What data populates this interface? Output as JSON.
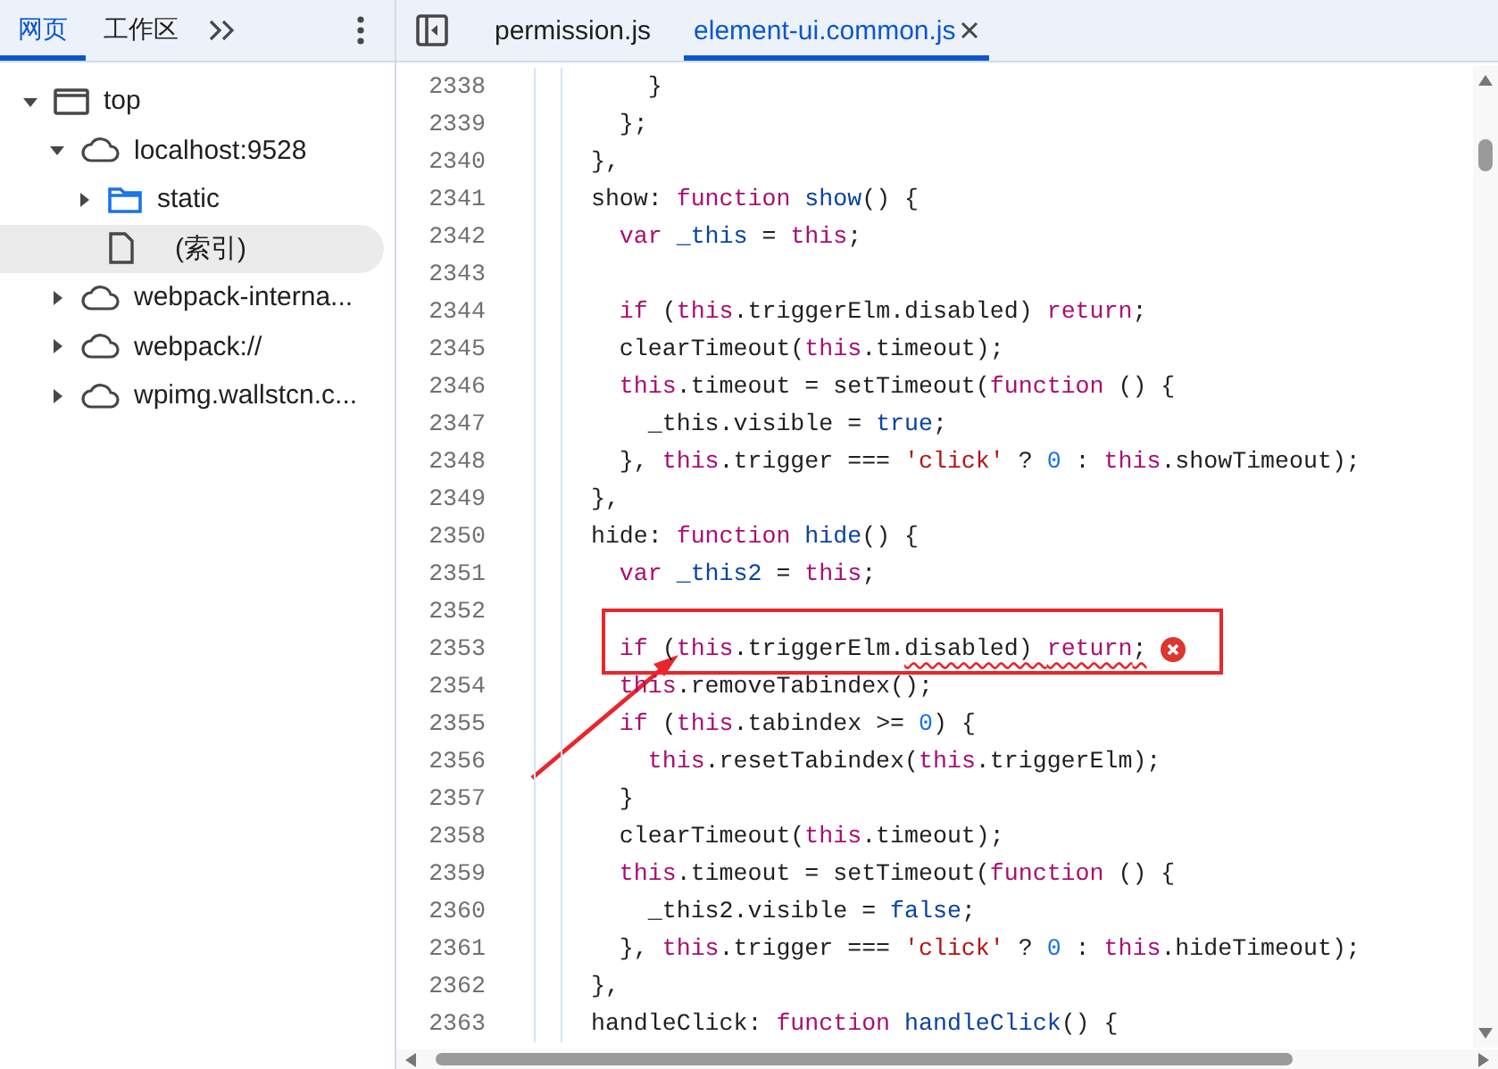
{
  "left_panel": {
    "tabs": [
      {
        "label": "网页",
        "selected": true
      },
      {
        "label": "工作区",
        "selected": false
      }
    ],
    "tree": [
      {
        "label": "top",
        "kind": "frame",
        "expanded": true,
        "selected": false,
        "children": [
          {
            "label": "localhost:9528",
            "kind": "cloud",
            "expanded": true,
            "selected": false,
            "children": [
              {
                "label": "static",
                "kind": "folder",
                "expanded": false,
                "selected": false
              },
              {
                "label": "(索引)",
                "kind": "file",
                "selected": true
              }
            ]
          },
          {
            "label": "webpack-interna...",
            "kind": "cloud",
            "expanded": false,
            "selected": false
          },
          {
            "label": "webpack://",
            "kind": "cloud",
            "expanded": false,
            "selected": false
          },
          {
            "label": "wpimg.wallstcn.c...",
            "kind": "cloud",
            "expanded": false,
            "selected": false
          }
        ]
      }
    ]
  },
  "editor": {
    "tabs": [
      {
        "label": "permission.js",
        "selected": false,
        "closable": false
      },
      {
        "label": "element-ui.common.js",
        "selected": true,
        "closable": true
      }
    ],
    "lines": [
      {
        "num": "2338",
        "error": false,
        "tokens": [
          {
            "t": "      }",
            "color": "#1f1f1f"
          }
        ]
      },
      {
        "num": "2339",
        "error": false,
        "tokens": [
          {
            "t": "    };",
            "color": "#1f1f1f"
          }
        ]
      },
      {
        "num": "2340",
        "error": false,
        "tokens": [
          {
            "t": "  },",
            "color": "#1f1f1f"
          }
        ]
      },
      {
        "num": "2341",
        "error": false,
        "tokens": [
          {
            "t": "  show: ",
            "color": "#1f1f1f"
          },
          {
            "t": "function",
            "color": "#aa0d71"
          },
          {
            "t": " show",
            "color": "#0842a0"
          },
          {
            "t": "() {",
            "color": "#1f1f1f"
          }
        ]
      },
      {
        "num": "2342",
        "error": false,
        "tokens": [
          {
            "t": "    var",
            "color": "#aa0d71"
          },
          {
            "t": " _this",
            "color": "#0842a0"
          },
          {
            "t": " = ",
            "color": "#1f1f1f"
          },
          {
            "t": "this",
            "color": "#aa0d71"
          },
          {
            "t": ";",
            "color": "#1f1f1f"
          }
        ]
      },
      {
        "num": "2343",
        "error": false
      },
      {
        "num": "2344",
        "error": false,
        "tokens": [
          {
            "t": "    if",
            "color": "#aa0d71"
          },
          {
            "t": " (",
            "color": "#1f1f1f"
          },
          {
            "t": "this",
            "color": "#aa0d71"
          },
          {
            "t": ".triggerElm.disabled) ",
            "color": "#1f1f1f"
          },
          {
            "t": "return",
            "color": "#aa0d71"
          },
          {
            "t": ";",
            "color": "#1f1f1f"
          }
        ]
      },
      {
        "num": "2345",
        "error": false,
        "tokens": [
          {
            "t": "    clearTimeout(",
            "color": "#1f1f1f"
          },
          {
            "t": "this",
            "color": "#aa0d71"
          },
          {
            "t": ".timeout);",
            "color": "#1f1f1f"
          }
        ]
      },
      {
        "num": "2346",
        "error": false,
        "tokens": [
          {
            "t": "    this",
            "color": "#aa0d71"
          },
          {
            "t": ".timeout = setTimeout(",
            "color": "#1f1f1f"
          },
          {
            "t": "function",
            "color": "#aa0d71"
          },
          {
            "t": " () {",
            "color": "#1f1f1f"
          }
        ]
      },
      {
        "num": "2347",
        "error": false,
        "tokens": [
          {
            "t": "      _this.visible = ",
            "color": "#1f1f1f"
          },
          {
            "t": "true",
            "color": "#0842a0"
          },
          {
            "t": ";",
            "color": "#1f1f1f"
          }
        ]
      },
      {
        "num": "2348",
        "error": false,
        "tokens": [
          {
            "t": "    }, ",
            "color": "#1f1f1f"
          },
          {
            "t": "this",
            "color": "#aa0d71"
          },
          {
            "t": ".trigger === ",
            "color": "#1f1f1f"
          },
          {
            "t": "'click'",
            "color": "#b31412"
          },
          {
            "t": " ? ",
            "color": "#1f1f1f"
          },
          {
            "t": "0",
            "color": "#1a73e8"
          },
          {
            "t": " : ",
            "color": "#1f1f1f"
          },
          {
            "t": "this",
            "color": "#aa0d71"
          },
          {
            "t": ".showTimeout);",
            "color": "#1f1f1f"
          }
        ]
      },
      {
        "num": "2349",
        "error": false,
        "tokens": [
          {
            "t": "  },",
            "color": "#1f1f1f"
          }
        ]
      },
      {
        "num": "2350",
        "error": false,
        "tokens": [
          {
            "t": "  hide: ",
            "color": "#1f1f1f"
          },
          {
            "t": "function",
            "color": "#aa0d71"
          },
          {
            "t": " hide",
            "color": "#0842a0"
          },
          {
            "t": "() {",
            "color": "#1f1f1f"
          }
        ]
      },
      {
        "num": "2351",
        "error": false,
        "tokens": [
          {
            "t": "    var",
            "color": "#aa0d71"
          },
          {
            "t": " _this2",
            "color": "#0842a0"
          },
          {
            "t": " = ",
            "color": "#1f1f1f"
          },
          {
            "t": "this",
            "color": "#aa0d71"
          },
          {
            "t": ";",
            "color": "#1f1f1f"
          }
        ]
      },
      {
        "num": "2352",
        "error": false
      },
      {
        "num": "2353",
        "error": true,
        "tokens": [
          {
            "t": "    if",
            "color": "#aa0d71",
            "wavy": false
          },
          {
            "t": " (",
            "color": "#1f1f1f",
            "wavy": false
          },
          {
            "t": "this",
            "color": "#aa0d71",
            "wavy": false
          },
          {
            "t": ".triggerElm.",
            "color": "#1f1f1f",
            "wavy": false
          },
          {
            "t": "disabled) ",
            "color": "#1f1f1f",
            "wavy": true
          },
          {
            "t": "return",
            "color": "#aa0d71",
            "wavy": true
          },
          {
            "t": ";",
            "color": "#1f1f1f",
            "wavy": true
          }
        ]
      },
      {
        "num": "2354",
        "error": false,
        "tokens": [
          {
            "t": "    this",
            "color": "#aa0d71"
          },
          {
            "t": ".removeTabindex();",
            "color": "#1f1f1f"
          }
        ]
      },
      {
        "num": "2355",
        "error": false,
        "tokens": [
          {
            "t": "    if",
            "color": "#aa0d71"
          },
          {
            "t": " (",
            "color": "#1f1f1f"
          },
          {
            "t": "this",
            "color": "#aa0d71"
          },
          {
            "t": ".tabindex >= ",
            "color": "#1f1f1f"
          },
          {
            "t": "0",
            "color": "#1a73e8"
          },
          {
            "t": ") {",
            "color": "#1f1f1f"
          }
        ]
      },
      {
        "num": "2356",
        "error": false,
        "tokens": [
          {
            "t": "      this",
            "color": "#aa0d71"
          },
          {
            "t": ".resetTabindex(",
            "color": "#1f1f1f"
          },
          {
            "t": "this",
            "color": "#aa0d71"
          },
          {
            "t": ".triggerElm);",
            "color": "#1f1f1f"
          }
        ]
      },
      {
        "num": "2357",
        "error": false,
        "tokens": [
          {
            "t": "    }",
            "color": "#1f1f1f"
          }
        ]
      },
      {
        "num": "2358",
        "error": false,
        "tokens": [
          {
            "t": "    clearTimeout(",
            "color": "#1f1f1f"
          },
          {
            "t": "this",
            "color": "#aa0d71"
          },
          {
            "t": ".timeout);",
            "color": "#1f1f1f"
          }
        ]
      },
      {
        "num": "2359",
        "error": false,
        "tokens": [
          {
            "t": "    this",
            "color": "#aa0d71"
          },
          {
            "t": ".timeout = setTimeout(",
            "color": "#1f1f1f"
          },
          {
            "t": "function",
            "color": "#aa0d71"
          },
          {
            "t": " () {",
            "color": "#1f1f1f"
          }
        ]
      },
      {
        "num": "2360",
        "error": false,
        "tokens": [
          {
            "t": "      _this2.visible = ",
            "color": "#1f1f1f"
          },
          {
            "t": "false",
            "color": "#0842a0"
          },
          {
            "t": ";",
            "color": "#1f1f1f"
          }
        ]
      },
      {
        "num": "2361",
        "error": false,
        "tokens": [
          {
            "t": "    }, ",
            "color": "#1f1f1f"
          },
          {
            "t": "this",
            "color": "#aa0d71"
          },
          {
            "t": ".trigger === ",
            "color": "#1f1f1f"
          },
          {
            "t": "'click'",
            "color": "#b31412"
          },
          {
            "t": " ? ",
            "color": "#1f1f1f"
          },
          {
            "t": "0",
            "color": "#1a73e8"
          },
          {
            "t": " : ",
            "color": "#1f1f1f"
          },
          {
            "t": "this",
            "color": "#aa0d71"
          },
          {
            "t": ".hideTimeout);",
            "color": "#1f1f1f"
          }
        ]
      },
      {
        "num": "2362",
        "error": false,
        "tokens": [
          {
            "t": "  },",
            "color": "#1f1f1f"
          }
        ]
      },
      {
        "num": "2363",
        "error": false,
        "tokens": [
          {
            "t": "  handleClick: ",
            "color": "#1f1f1f"
          },
          {
            "t": "function",
            "color": "#aa0d71"
          },
          {
            "t": " handleClick",
            "color": "#0842a0"
          },
          {
            "t": "() {",
            "color": "#1f1f1f"
          }
        ]
      }
    ]
  }
}
